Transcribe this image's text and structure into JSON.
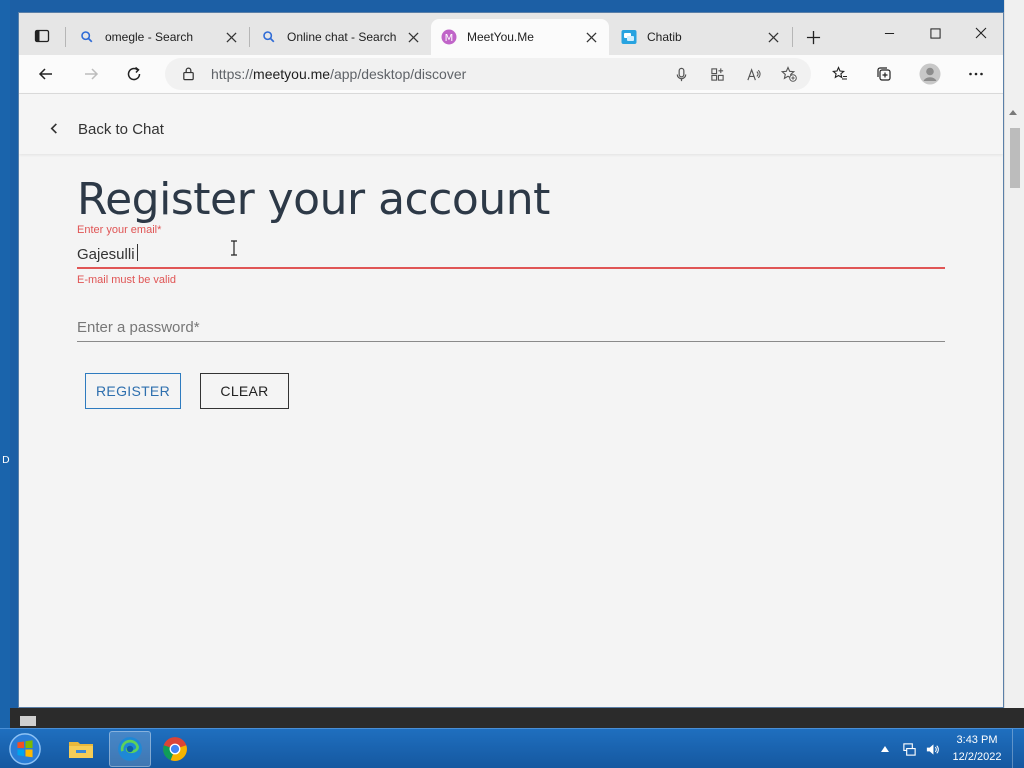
{
  "browser": {
    "tabs": [
      {
        "title": "omegle - Search",
        "icon": "search-icon"
      },
      {
        "title": "Online chat - Search",
        "icon": "search-icon"
      },
      {
        "title": "MeetYou.Me",
        "icon": "meetyou-logo",
        "active": true
      },
      {
        "title": "Chatib",
        "icon": "chatib-logo"
      }
    ],
    "address": {
      "prefix": "https://",
      "domain": "meetyou.me",
      "path": "/app/desktop/discover"
    }
  },
  "page": {
    "back_label": "Back to Chat",
    "title": "Register your account",
    "email": {
      "label": "Enter your email*",
      "value": "Gajesulli",
      "error": "E-mail must be valid"
    },
    "password": {
      "placeholder": "Enter a password*"
    },
    "buttons": {
      "register": "REGISTER",
      "clear": "CLEAR"
    }
  },
  "colors": {
    "error": "#e05555",
    "primary": "#2e7bbf",
    "title": "#2d3947"
  },
  "desktop": {
    "side_label": "D"
  },
  "taskbar": {
    "time": "3:43 PM",
    "date": "12/2/2022",
    "apps": [
      "windows-start",
      "file-explorer",
      "microsoft-edge",
      "google-chrome"
    ]
  }
}
